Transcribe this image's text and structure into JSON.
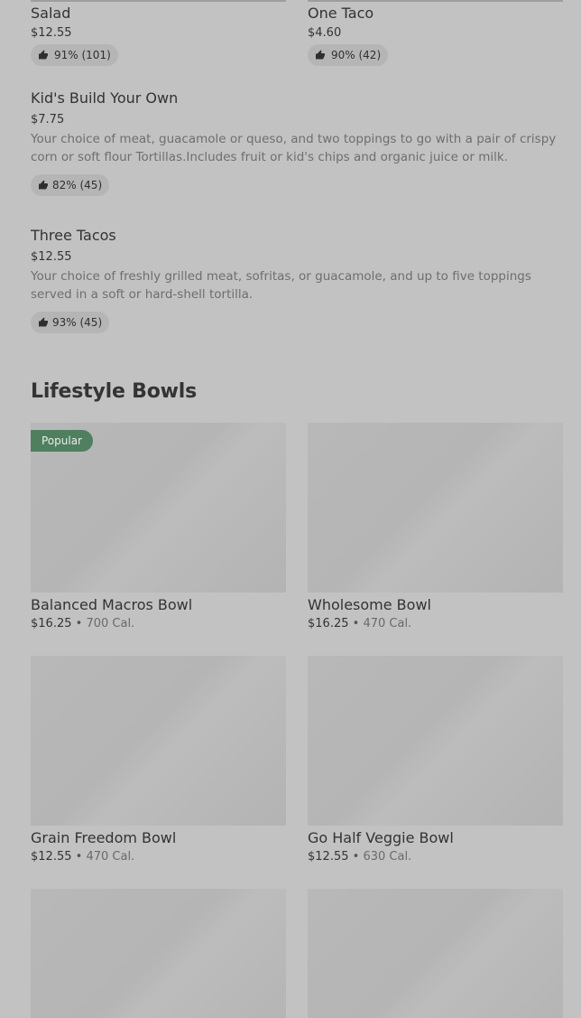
{
  "top_items": [
    {
      "name": "Salad",
      "price": "$12.55",
      "rating": "91% (101)"
    },
    {
      "name": "One Taco",
      "price": "$4.60",
      "rating": "90% (42)"
    }
  ],
  "list_items": [
    {
      "name": "Kid's Build Your Own",
      "price": "$7.75",
      "description": "Your choice of meat, guacamole or queso, and two toppings to go with a pair of crispy corn or soft flour Tortillas.Includes fruit or kid's chips and organic juice or milk.",
      "rating": "82% (45)"
    },
    {
      "name": "Three Tacos",
      "price": "$12.55",
      "description": "Your choice of freshly grilled meat, sofritas, or guacamole, and up to five toppings served in a soft or hard-shell tortilla.",
      "rating": "93% (45)"
    }
  ],
  "section": {
    "title": "Lifestyle Bowls"
  },
  "bowls": [
    {
      "name": "Balanced Macros Bowl",
      "price": "$16.25",
      "separator": "•",
      "calories": "700 Cal.",
      "badge": "Popular"
    },
    {
      "name": "Wholesome Bowl",
      "price": "$16.25",
      "separator": "•",
      "calories": "470 Cal."
    },
    {
      "name": "Grain Freedom Bowl",
      "price": "$12.55",
      "separator": "•",
      "calories": "470 Cal."
    },
    {
      "name": "Go Half Veggie Bowl",
      "price": "$12.55",
      "separator": "•",
      "calories": "630 Cal."
    }
  ],
  "icons": {
    "rating": "thumbs-up-icon"
  },
  "colors": {
    "background": "#c2c2c2",
    "badge": "#4f7f5f",
    "image_placeholder": "#b8b8b8"
  }
}
